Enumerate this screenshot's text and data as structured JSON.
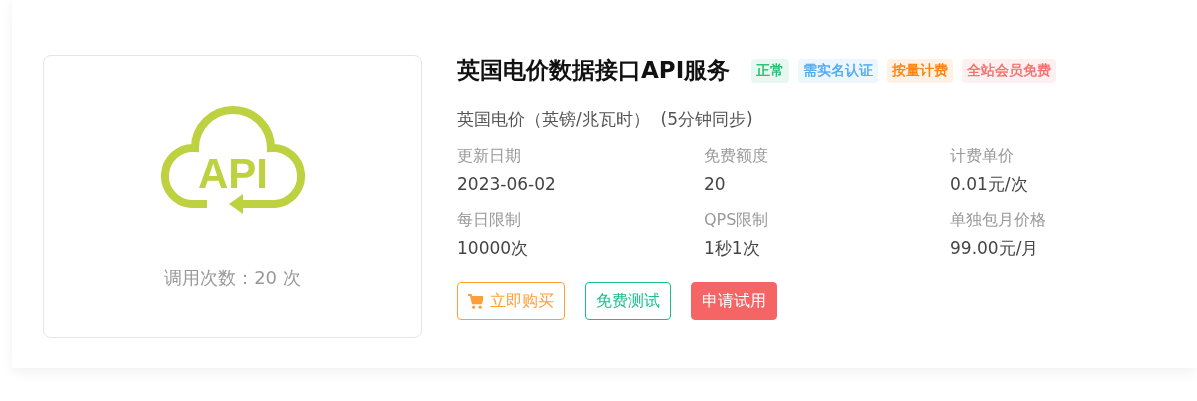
{
  "product": {
    "logo_text": "API",
    "call_count": "调用次数：20 次",
    "title": "英国电价数据接口API服务",
    "tags": [
      {
        "label": "正常",
        "color": "#19be6b"
      },
      {
        "label": "需实名认证",
        "color": "#4aa8f0"
      },
      {
        "label": "按量计费",
        "color": "#ff7d00"
      },
      {
        "label": "全站会员免费",
        "color": "#f56c6c"
      }
    ],
    "subtitle": "英国电价（英镑/兆瓦时）  (5分钟同步)",
    "fields": [
      {
        "label": "更新日期",
        "value": "2023-06-02"
      },
      {
        "label": "免费额度",
        "value": "20"
      },
      {
        "label": "计费单价",
        "value": "0.01元/次"
      },
      {
        "label": "每日限制",
        "value": "10000次"
      },
      {
        "label": "QPS限制",
        "value": "1秒1次"
      },
      {
        "label": "单独包月价格",
        "value": "99.00元/月"
      }
    ],
    "buttons": [
      {
        "label": "立即购买",
        "kind": "cart",
        "color": "#ff9f38"
      },
      {
        "label": "免费测试",
        "kind": "outline",
        "color": "#19be8b"
      },
      {
        "label": "申请试用",
        "kind": "filled",
        "color": "#f56565"
      }
    ]
  }
}
